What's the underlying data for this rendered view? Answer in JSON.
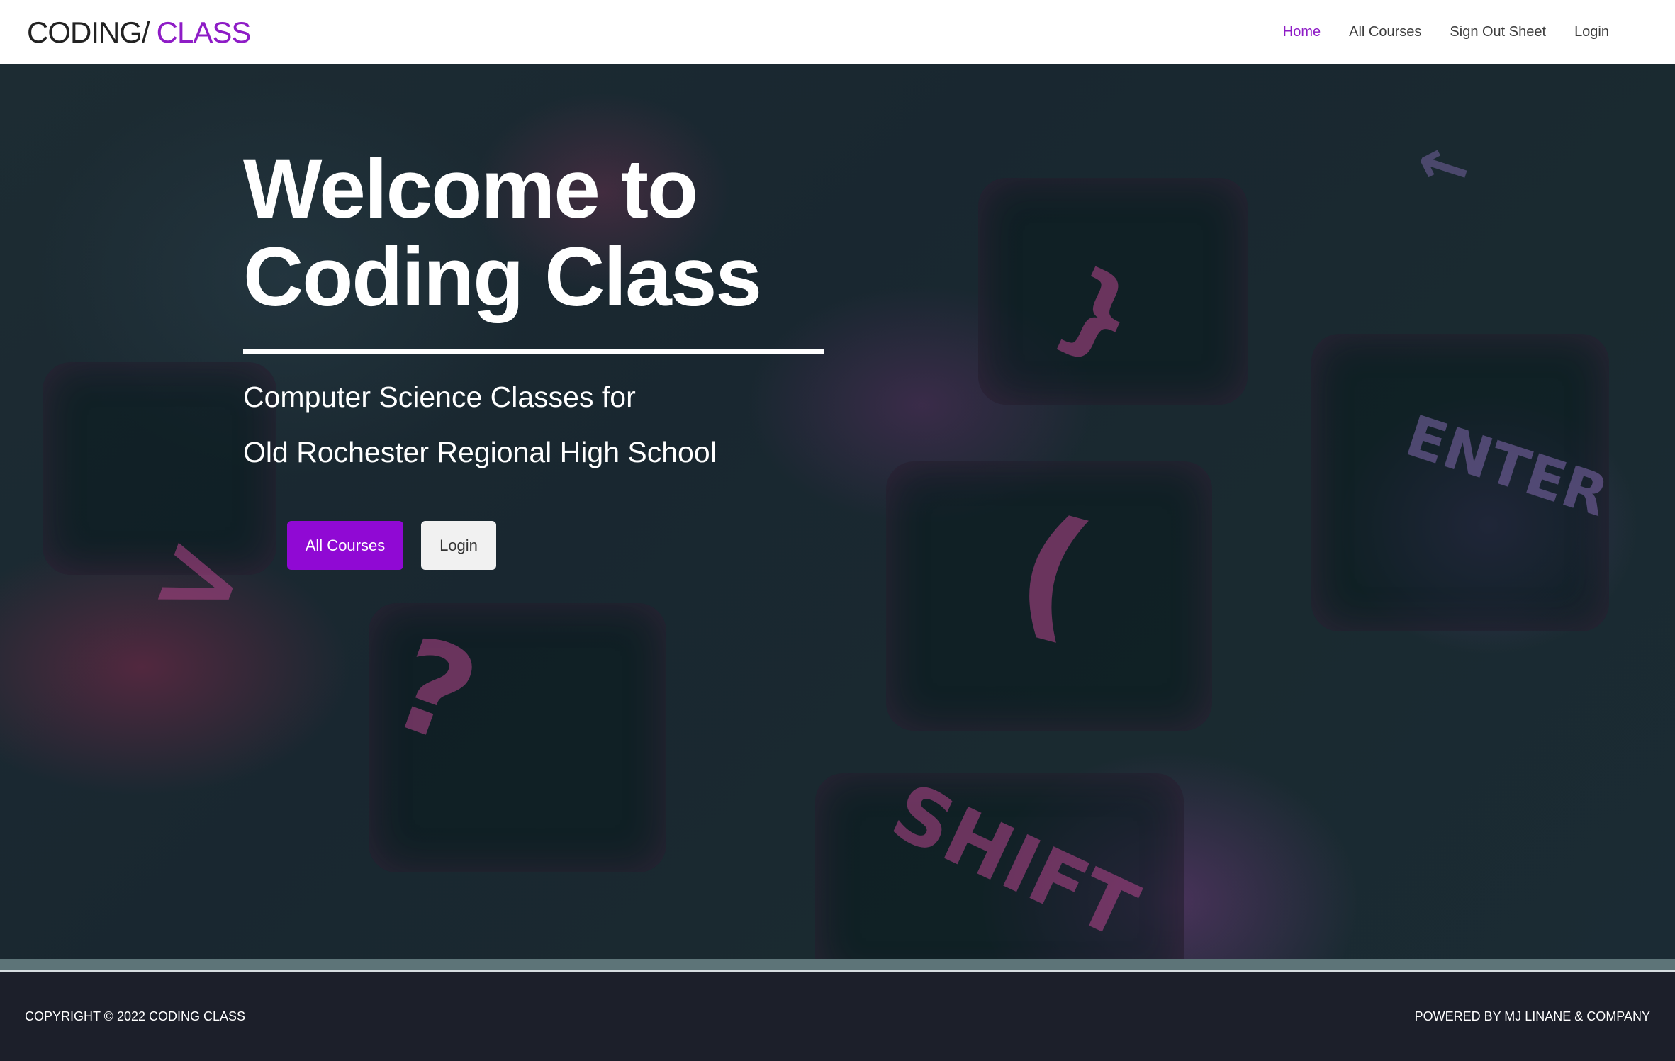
{
  "header": {
    "logo_main": "CODING/",
    "logo_accent": "CLASS",
    "nav": [
      {
        "label": "Home",
        "active": true
      },
      {
        "label": "All Courses",
        "active": false
      },
      {
        "label": "Sign Out Sheet",
        "active": false
      },
      {
        "label": "Login",
        "active": false
      }
    ]
  },
  "hero": {
    "title_line1": "Welcome to",
    "title_line2": "Coding Class",
    "subtitle_line1": "Computer Science Classes for",
    "subtitle_line2": "Old Rochester Regional High School",
    "primary_button": "All Courses",
    "secondary_button": "Login"
  },
  "footer": {
    "copyright": "COPYRIGHT © 2022 CODING CLASS",
    "powered_by": "POWERED BY MJ LINANE & COMPANY"
  },
  "colors": {
    "accent": "#8e1cc6",
    "button_primary": "#9009d4",
    "footer_bg": "#1c1f2a"
  }
}
